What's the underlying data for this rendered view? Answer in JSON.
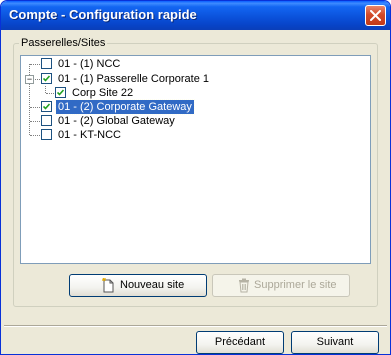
{
  "window": {
    "title": "Compte - Configuration rapide"
  },
  "group": {
    "label": "Passerelles/Sites"
  },
  "tree": {
    "items": [
      {
        "label": "01 - (1)  NCC",
        "checked": false,
        "selected": false
      },
      {
        "label": "01 - (1)  Passerelle Corporate 1",
        "checked": true,
        "selected": false,
        "expanded": true
      },
      {
        "label": "Corp Site 22",
        "checked": true,
        "selected": false
      },
      {
        "label": "01 - (2)  Corporate Gateway",
        "checked": true,
        "selected": true
      },
      {
        "label": "01 - (2)  Global Gateway",
        "checked": false,
        "selected": false
      },
      {
        "label": "01 - KT-NCC",
        "checked": false,
        "selected": false
      }
    ]
  },
  "buttons": {
    "new_site": "Nouveau site",
    "delete_site": "Supprimer le site",
    "previous": "Précédant",
    "next": "Suivant"
  },
  "colors": {
    "titlebar": "#0a4fd8",
    "selection": "#316ac5",
    "dialog_bg": "#ece9d8"
  }
}
